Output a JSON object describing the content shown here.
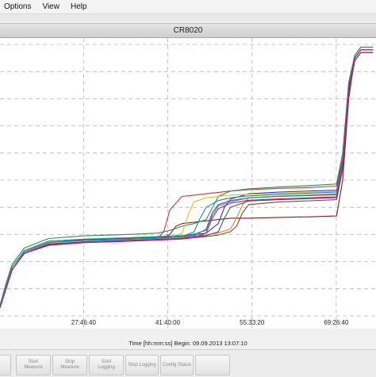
{
  "menu": {
    "items": [
      "Options",
      "View",
      "Help"
    ]
  },
  "window": {
    "title": "CR8020"
  },
  "chart_data": {
    "type": "line",
    "xlabel": "Time [hh:mm:ss]  Begin: 09.09.2013 13:07:10",
    "x_tick_labels": [
      "27:46:40",
      "41:40:00",
      "55:33:20",
      "69:26:40"
    ],
    "x_ticks_hours": [
      27.778,
      41.667,
      55.556,
      69.444
    ],
    "xlim": [
      14,
      76
    ],
    "ylim": [
      0,
      100
    ],
    "grid": true,
    "series": [
      {
        "color": "#7a1f1f",
        "x": [
          14,
          15,
          16,
          18,
          22,
          28,
          35,
          40,
          42,
          43,
          44,
          46,
          48,
          50,
          52,
          55,
          60,
          65,
          69.5,
          70.5,
          71.5,
          72.5,
          73.5,
          75.5
        ],
        "y": [
          3,
          10,
          17,
          23,
          26,
          27,
          27.5,
          28,
          30,
          33,
          34,
          34.5,
          35,
          35.5,
          36,
          36,
          36.3,
          36.5,
          36.8,
          50,
          80,
          95,
          98,
          98
        ]
      },
      {
        "color": "#c0392b",
        "x": [
          14,
          15,
          16,
          18,
          22,
          28,
          35,
          40,
          41,
          42,
          44,
          46,
          48,
          50,
          52,
          55,
          60,
          65,
          69.5,
          70.5,
          71.5,
          72.5,
          73.5,
          75.5
        ],
        "y": [
          4,
          11,
          18,
          24,
          27,
          28,
          28.3,
          28.6,
          31,
          39,
          44,
          44.5,
          45,
          45.5,
          46,
          46.5,
          47,
          47.3,
          47.8,
          58,
          85,
          96,
          99,
          99
        ]
      },
      {
        "color": "#2e8b57",
        "x": [
          14,
          15,
          16,
          18,
          22,
          28,
          35,
          40,
          42,
          44,
          46,
          48,
          50,
          52,
          55,
          60,
          65,
          69.5,
          70.5,
          71.5,
          72.5,
          73.5,
          75.5
        ],
        "y": [
          4,
          12,
          19,
          25,
          28.5,
          29.5,
          30,
          30.5,
          31.5,
          33,
          34,
          35.5,
          44,
          46,
          46.8,
          47.5,
          48,
          48.6,
          60,
          86,
          96,
          99,
          99
        ]
      },
      {
        "color": "#1f3fbf",
        "x": [
          14,
          15,
          16,
          18,
          22,
          28,
          35,
          40,
          44,
          46,
          48,
          50,
          51,
          52,
          55,
          60,
          65,
          69.5,
          70.5,
          71.5,
          72.5,
          73.5,
          75.5
        ],
        "y": [
          3,
          11,
          18,
          24,
          27.5,
          28.2,
          28.6,
          29,
          29.3,
          29.8,
          30.5,
          34,
          40,
          43,
          45,
          45.6,
          46,
          46.3,
          57,
          84,
          95,
          98,
          98
        ]
      },
      {
        "color": "#d4c21a",
        "x": [
          14,
          15,
          16,
          18,
          22,
          28,
          35,
          40,
          42,
          44,
          45,
          46,
          48,
          50,
          52,
          55,
          60,
          65,
          69.5,
          70.5,
          71.5,
          72.5,
          73.5,
          75.5
        ],
        "y": [
          3,
          10,
          17,
          23,
          26.5,
          27.3,
          27.8,
          28.2,
          28.8,
          30.5,
          37,
          42,
          43.5,
          44,
          44.5,
          44.8,
          45.2,
          45.5,
          45.8,
          56,
          83,
          95,
          98,
          98
        ]
      },
      {
        "color": "#e67e22",
        "x": [
          14,
          15,
          16,
          18,
          22,
          28,
          35,
          40,
          44,
          46,
          48,
          50,
          52,
          53,
          54,
          55,
          60,
          65,
          69.5,
          70.5,
          71.5,
          72.5,
          73.5,
          75.5
        ],
        "y": [
          3,
          11,
          18,
          24,
          27,
          27.8,
          28.3,
          28.7,
          29,
          29.3,
          29.8,
          30.6,
          32,
          36,
          41,
          43.5,
          44.2,
          44.6,
          45,
          56,
          83,
          95,
          98,
          98
        ]
      },
      {
        "color": "#8e44ad",
        "x": [
          14,
          15,
          16,
          18,
          22,
          28,
          35,
          40,
          44,
          46,
          48,
          49,
          50,
          52,
          55,
          60,
          65,
          69.5,
          70.5,
          71.5,
          72.5,
          73.5,
          75.5
        ],
        "y": [
          3,
          10,
          17,
          23,
          26.5,
          27.2,
          27.7,
          28.1,
          28.6,
          29.4,
          32,
          38,
          41,
          42.5,
          43.5,
          44,
          44.3,
          44.6,
          55,
          82,
          94,
          97,
          97
        ]
      },
      {
        "color": "#2980b9",
        "x": [
          14,
          15,
          16,
          18,
          22,
          28,
          35,
          40,
          44,
          46,
          47,
          48,
          50,
          52,
          55,
          60,
          65,
          69.5,
          70.5,
          71.5,
          72.5,
          73.5,
          75.5
        ],
        "y": [
          3,
          10,
          17,
          23.5,
          27,
          27.8,
          28.2,
          28.6,
          29.2,
          31,
          36,
          40,
          42.5,
          43.5,
          44.2,
          44.8,
          45.2,
          45.6,
          56,
          83,
          95,
          98,
          98
        ]
      },
      {
        "color": "#16a085",
        "x": [
          14,
          15,
          16,
          18,
          22,
          28,
          35,
          40,
          44,
          46,
          48,
          49,
          50,
          52,
          55,
          60,
          65,
          69.5,
          70.5,
          71.5,
          72.5,
          73.5,
          75.5
        ],
        "y": [
          3.5,
          11,
          18,
          24,
          27.5,
          28.3,
          28.8,
          29.2,
          29.6,
          30.2,
          31.5,
          37,
          40.5,
          42,
          43.5,
          44,
          44.4,
          44.8,
          55,
          83,
          95,
          98,
          98
        ]
      },
      {
        "color": "#555555",
        "x": [
          14,
          15,
          16,
          18,
          22,
          28,
          35,
          40,
          44,
          46,
          48,
          50,
          51,
          52,
          55,
          60,
          65,
          69.5,
          70.5,
          71.5,
          72.5,
          73.5,
          75.5
        ],
        "y": [
          3,
          10,
          17,
          23,
          26.5,
          27.3,
          27.8,
          28.2,
          28.6,
          29,
          29.6,
          31,
          36,
          40,
          42.3,
          42.8,
          43.2,
          43.5,
          54,
          82,
          94,
          97,
          97
        ]
      },
      {
        "color": "#6d4c41",
        "x": [
          14,
          15,
          16,
          18,
          22,
          28,
          35,
          40,
          44,
          46,
          48,
          50,
          52,
          53,
          54,
          55,
          60,
          65,
          69.5,
          70.5,
          71.5,
          72.5,
          73.5,
          75.5
        ],
        "y": [
          3,
          10,
          17,
          23,
          26.5,
          27.2,
          27.6,
          28,
          28.4,
          28.8,
          29.2,
          29.8,
          31,
          33,
          38,
          41,
          42,
          42.4,
          42.8,
          54,
          82,
          94,
          97,
          97
        ]
      },
      {
        "color": "#c71585",
        "x": [
          14,
          15,
          16,
          18,
          22,
          28,
          35,
          40,
          44,
          46,
          48,
          49,
          50,
          52,
          55,
          60,
          65,
          69.5,
          70.5,
          71.5,
          72.5,
          73.5,
          75.5
        ],
        "y": [
          3,
          10,
          17,
          23,
          26.3,
          27,
          27.5,
          27.9,
          28.3,
          28.9,
          30.5,
          36,
          39.5,
          41.5,
          42.6,
          43.1,
          43.5,
          43.9,
          55,
          83,
          95,
          98,
          98
        ]
      }
    ]
  },
  "toolbar": {
    "buttons": [
      {
        "label": ""
      },
      {
        "label": "Start\nMeasure"
      },
      {
        "label": "Stop\nMeasure"
      },
      {
        "label": "Start\nLogging"
      },
      {
        "label": "Stop Logging"
      },
      {
        "label": "Config Status"
      },
      {
        "label": ""
      }
    ]
  }
}
